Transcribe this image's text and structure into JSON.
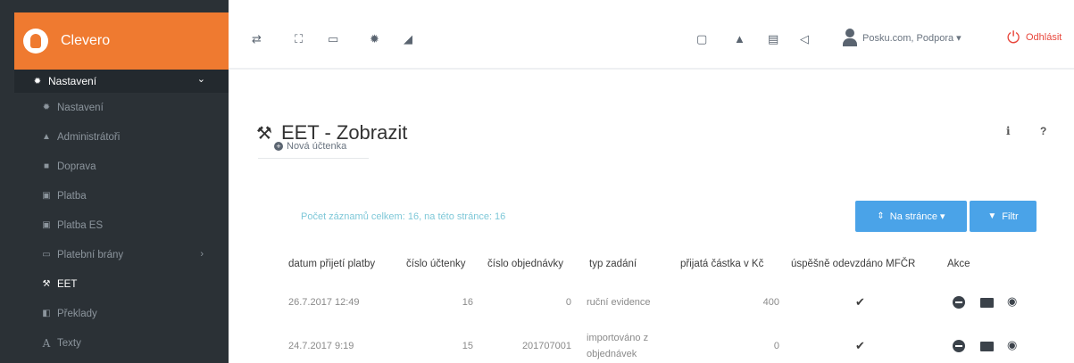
{
  "brand": {
    "name": "Clevero"
  },
  "sidebar": {
    "group_label": "Nastavení",
    "items": [
      {
        "label": "Nastavení",
        "icon": "gear-icon"
      },
      {
        "label": "Administrátoři",
        "icon": "graduation-cap-icon"
      },
      {
        "label": "Doprava",
        "icon": "truck-icon"
      },
      {
        "label": "Platba",
        "icon": "money-icon"
      },
      {
        "label": "Platba ES",
        "icon": "money-icon"
      },
      {
        "label": "Platební brány",
        "icon": "credit-card-icon",
        "has_submenu": true
      },
      {
        "label": "EET",
        "icon": "gavel-icon",
        "active": true
      },
      {
        "label": "Překlady",
        "icon": "translate-icon"
      },
      {
        "label": "Texty",
        "icon": "font-icon"
      }
    ]
  },
  "topbar": {
    "user": "Posku.com, Podpora ▾",
    "logout": "Odhlásit"
  },
  "page": {
    "title": "EET - Zobrazit",
    "new_receipt": "Nová účtenka",
    "info": "i",
    "help": "?",
    "record_count": "Počet záznamů celkem: 16, na této stránce: 16",
    "per_page_btn": "Na stránce ▾",
    "filter_btn": "Filtr"
  },
  "table": {
    "columns": [
      "datum přijetí platby",
      "číslo účtenky",
      "číslo objednávky",
      "typ zadání",
      "přijatá částka v Kč",
      "úspěšně odevzdáno MFČR",
      "Akce"
    ],
    "rows": [
      {
        "date": "26.7.2017 12:49",
        "receipt": "16",
        "order": "0",
        "type": "ruční evidence",
        "type2": "",
        "amount": "400",
        "submitted": true
      },
      {
        "date": "24.7.2017 9:19",
        "receipt": "15",
        "order": "201707001",
        "type": "importováno z",
        "type2": "objednávek",
        "amount": "0",
        "submitted": true
      }
    ]
  },
  "colors": {
    "brand": "#ef7a30",
    "sidebar": "#2b3136",
    "primary_button": "#4aa3e8",
    "logout": "#e8463b",
    "count_text": "#7fc8d8"
  }
}
